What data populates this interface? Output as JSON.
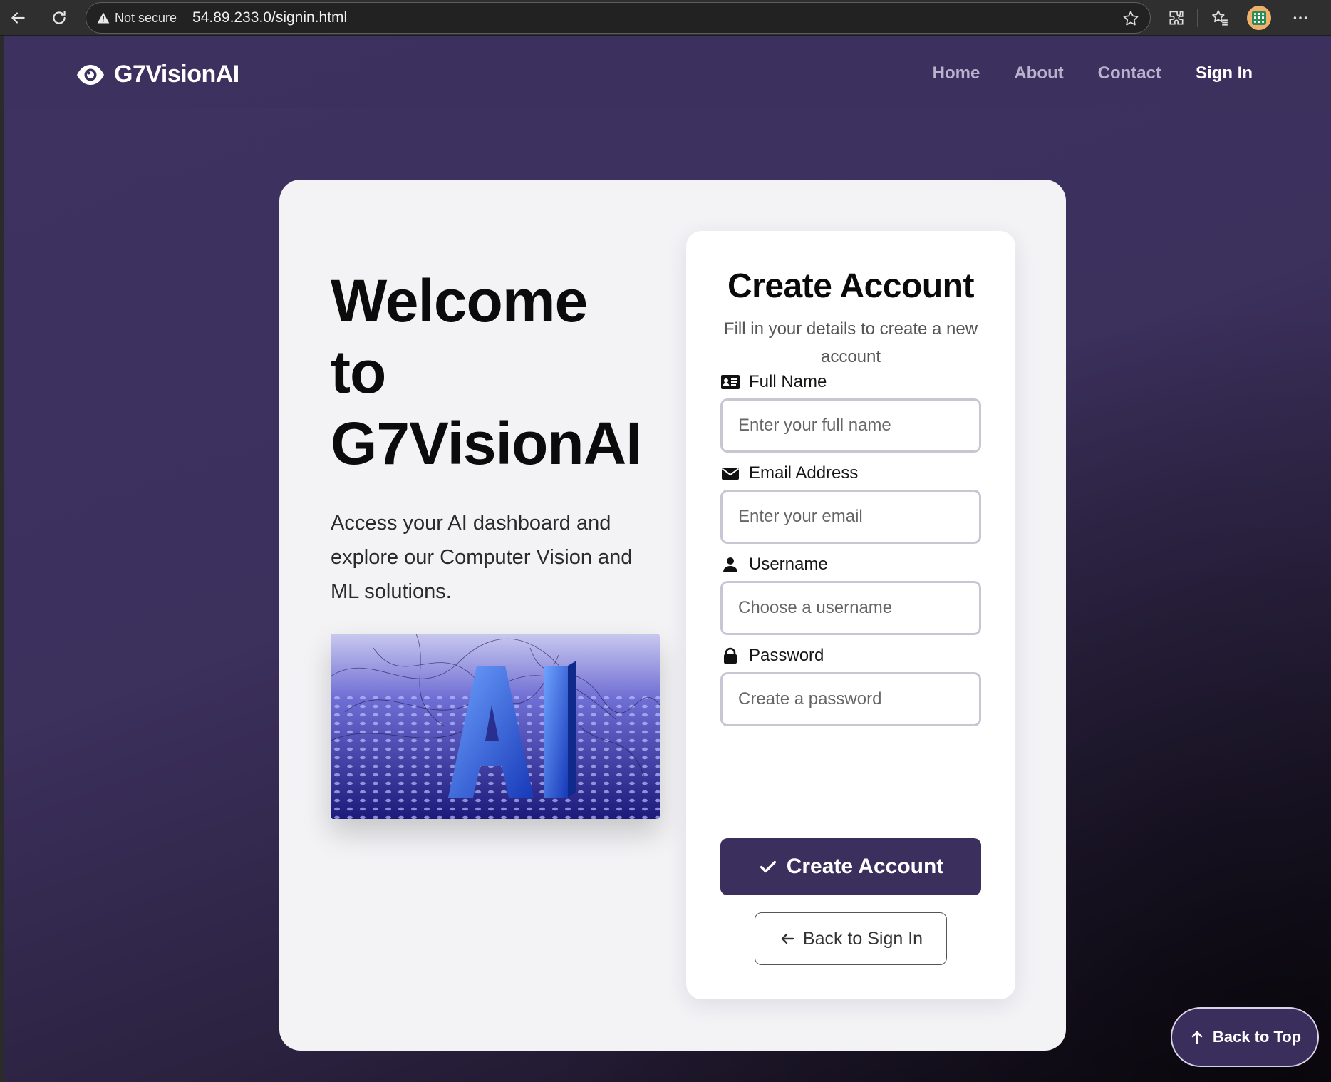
{
  "browser": {
    "security_label": "Not secure",
    "url": "54.89.233.0/signin.html"
  },
  "site": {
    "brand": "G7VisionAI",
    "nav": [
      "Home",
      "About",
      "Contact",
      "Sign In"
    ],
    "active_nav": "Sign In"
  },
  "welcome": {
    "line1": "Welcome",
    "line2": "to",
    "line3": "G7VisionAI",
    "subtitle": "Access your AI dashboard and explore our Computer Vision and ML solutions."
  },
  "form": {
    "title": "Create Account",
    "subtitle": "Fill in your details to create a new account",
    "fields": [
      {
        "label": "Full Name",
        "placeholder": "Enter your full name",
        "icon": "id-card-icon"
      },
      {
        "label": "Email Address",
        "placeholder": "Enter your email",
        "icon": "envelope-icon"
      },
      {
        "label": "Username",
        "placeholder": "Choose a username",
        "icon": "user-icon"
      },
      {
        "label": "Password",
        "placeholder": "Create a password",
        "icon": "lock-icon"
      }
    ],
    "submit_label": "Create Account",
    "back_label": "Back to Sign In"
  },
  "back_to_top": "Back to Top",
  "colors": {
    "brand_dark": "#3b2f5e",
    "page_bg": "#3c305d",
    "card_bg": "#f3f3f6"
  }
}
